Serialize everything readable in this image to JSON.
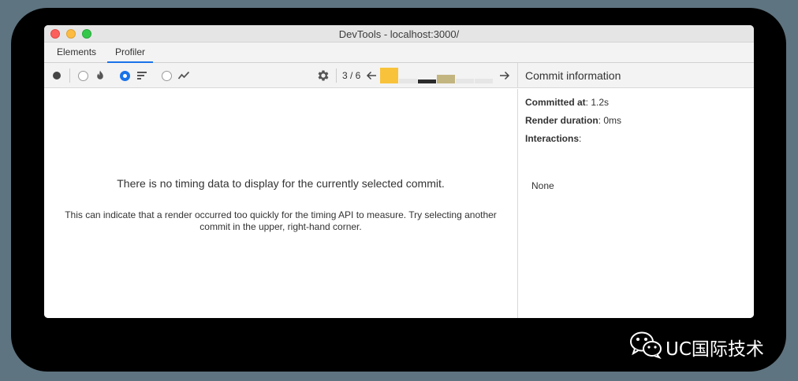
{
  "window": {
    "title": "DevTools - localhost:3000/"
  },
  "tabs": [
    {
      "label": "Elements",
      "active": false
    },
    {
      "label": "Profiler",
      "active": true
    }
  ],
  "toolbar": {
    "record_icon": "record-icon",
    "views": [
      {
        "icon": "flame-icon",
        "selected": false
      },
      {
        "icon": "ranked-icon",
        "selected": true
      },
      {
        "icon": "interactions-icon",
        "selected": false
      }
    ],
    "settings_icon": "gear-icon",
    "commit_counter": "3 / 6",
    "commits": [
      {
        "color": "#f8c33a",
        "height": 1.0
      },
      {
        "color": "#e6e6e6",
        "height": 0.3
      },
      {
        "color": "#2b2b2b",
        "height": 0.25
      },
      {
        "color": "#c3b57f",
        "height": 0.55
      },
      {
        "color": "#e6e6e6",
        "height": 0.3
      },
      {
        "color": "#e6e6e6",
        "height": 0.3
      }
    ]
  },
  "main": {
    "message": "There is no timing data to display for the currently selected commit.",
    "hint": "This can indicate that a render occurred too quickly for the timing API to measure. Try selecting another commit in the upper, right-hand corner."
  },
  "sidebar": {
    "title": "Commit information",
    "committed_at_label": "Committed at",
    "committed_at_value": ": 1.2s",
    "render_duration_label": "Render duration",
    "render_duration_value": ": 0ms",
    "interactions_label": "Interactions",
    "interactions_suffix": ":",
    "interactions_value": "None"
  },
  "watermark": {
    "text": "UC国际技术",
    "icon": "wechat-icon"
  },
  "colors": {
    "accent": "#1a73e8",
    "background": "#5e7480"
  }
}
